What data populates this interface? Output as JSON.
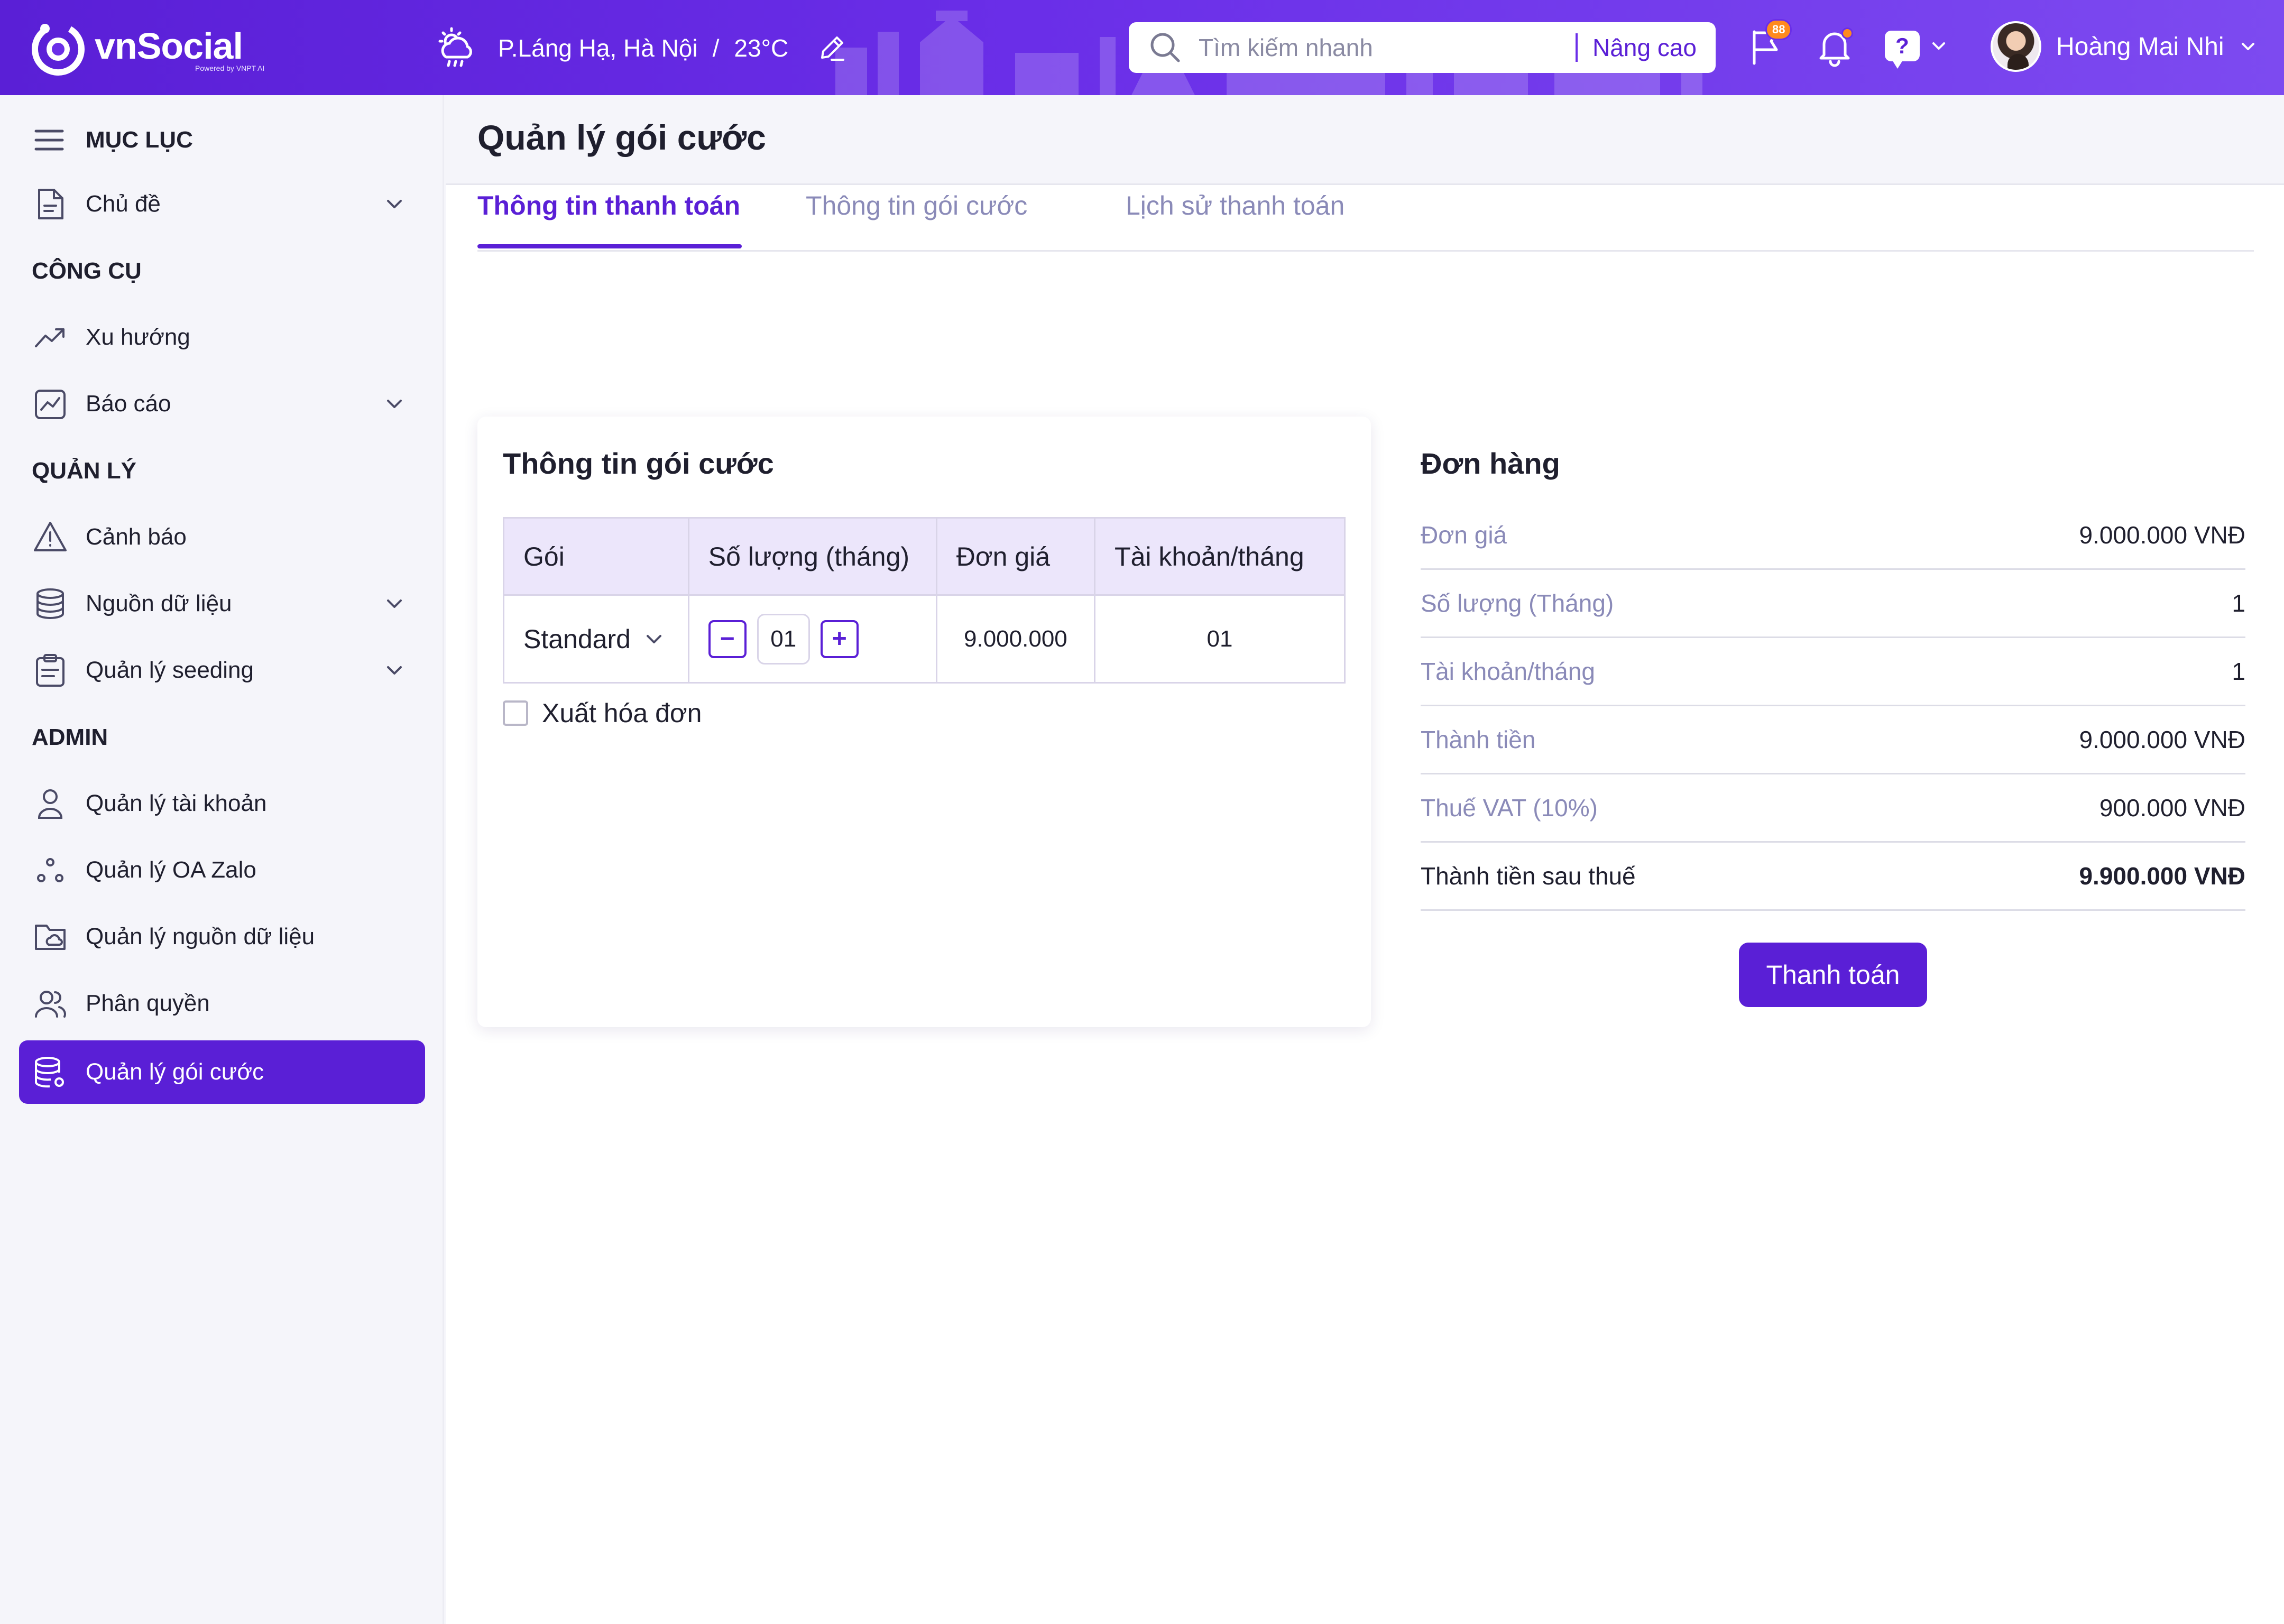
{
  "app": {
    "logo_name": "vnSocial",
    "logo_sub": "Powered by VNPT AI"
  },
  "header": {
    "weather_location": "P.Láng Hạ, Hà Nội",
    "weather_sep": "/",
    "weather_temp": "23°C",
    "search_placeholder": "Tìm kiếm nhanh",
    "search_advanced": "Nâng cao",
    "flag_badge": "88",
    "help_label": "?",
    "user_name": "Hoàng Mai Nhi"
  },
  "sidebar": {
    "menu_title": "MỤC LỤC",
    "sections": {
      "tools": "CÔNG CỤ",
      "manage": "QUẢN LÝ",
      "admin": "ADMIN"
    },
    "items": {
      "topic": "Chủ đề",
      "trend": "Xu hướng",
      "report": "Báo cáo",
      "alert": "Cảnh báo",
      "datasource": "Nguồn dữ liệu",
      "seeding": "Quản lý seeding",
      "accounts": "Quản lý tài khoản",
      "oa_zalo": "Quản lý OA Zalo",
      "ds_manage": "Quản lý nguồn dữ liệu",
      "permission": "Phân quyền",
      "plans": "Quản lý gói cước"
    }
  },
  "page": {
    "title": "Quản lý gói cước",
    "tabs": [
      "Thông tin thanh toán",
      "Thông tin gói cước",
      "Lịch sử thanh toán"
    ],
    "active_tab": 0
  },
  "package_card": {
    "title": "Thông tin gói cước",
    "columns": [
      "Gói",
      "Số lượng (tháng)",
      "Đơn giá",
      "Tài khoản/tháng"
    ],
    "row": {
      "package": "Standard",
      "minus": "−",
      "quantity": "01",
      "plus": "+",
      "price": "9.000.000",
      "accounts": "01"
    },
    "invoice_label": "Xuất hóa đơn",
    "invoice_checked": false
  },
  "order": {
    "title": "Đơn hàng",
    "rows": [
      {
        "label": "Đơn giá",
        "value": "9.000.000 VNĐ"
      },
      {
        "label": "Số lượng (Tháng)",
        "value": "1"
      },
      {
        "label": "Tài khoản/tháng",
        "value": "1"
      },
      {
        "label": "Thành tiền",
        "value": "9.000.000 VNĐ"
      },
      {
        "label": "Thuế VAT (10%)",
        "value": "900.000 VNĐ"
      },
      {
        "label": "Thành tiền sau thuế",
        "value": "9.900.000 VNĐ"
      }
    ],
    "pay_button": "Thanh toán"
  },
  "colors": {
    "primary": "#5a1fd6",
    "header_gradient_end": "#7d4af0",
    "badge": "#ff8a1d",
    "table_header_bg": "#ece6fb",
    "muted_text": "#8a8ab8"
  }
}
